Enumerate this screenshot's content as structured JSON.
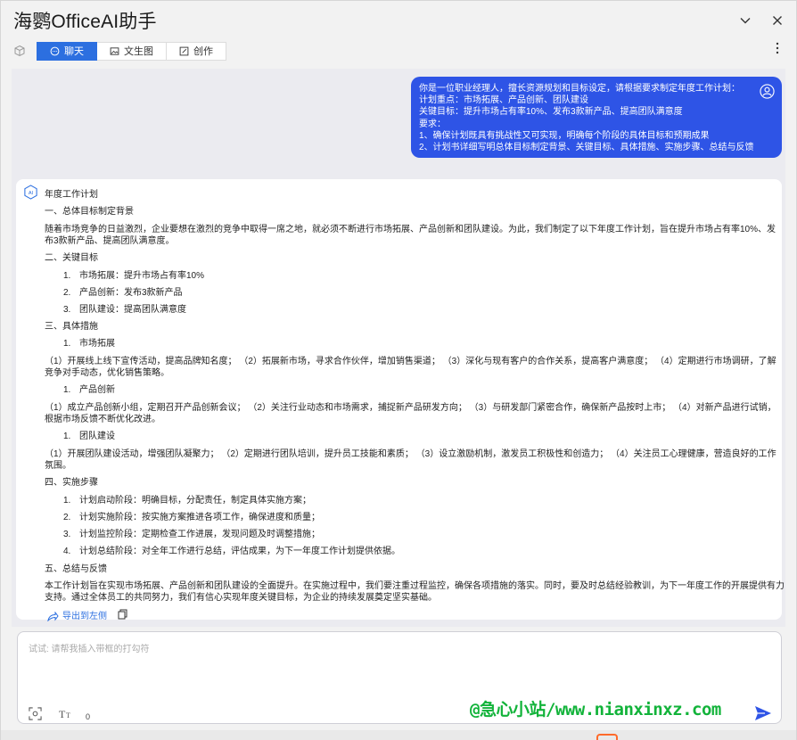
{
  "app": {
    "title": "海鹦OfficeAI助手"
  },
  "toolbar": {
    "tabs": [
      {
        "label": "聊天",
        "icon": "chat-icon",
        "active": true
      },
      {
        "label": "文生图",
        "icon": "image-icon",
        "active": false
      },
      {
        "label": "创作",
        "icon": "edit-icon",
        "active": false
      }
    ]
  },
  "user_message": {
    "lines": [
      "你是一位职业经理人，擅长资源规划和目标设定，请根据要求制定年度工作计划：",
      "计划重点：市场拓展、产品创新、团队建设",
      "关键目标：提升市场占有率10%、发布3款新产品、提高团队满意度",
      "要求：",
      "1、确保计划既具有挑战性又可实现，明确每个阶段的具体目标和预期成果",
      "2、计划书详细写明总体目标制定背景、关键目标、具体措施、实施步骤、总结与反馈"
    ]
  },
  "ai_response": {
    "title": "年度工作计划",
    "s1_heading": "一、总体目标制定背景",
    "s1_body": "随着市场竞争的日益激烈，企业要想在激烈的竞争中取得一席之地，就必须不断进行市场拓展、产品创新和团队建设。为此，我们制定了以下年度工作计划，旨在提升市场占有率10%、发布3款新产品、提高团队满意度。",
    "s2_heading": "二、关键目标",
    "s2_items": [
      "1.",
      "市场拓展：提升市场占有率10%",
      "2.",
      "产品创新：发布3款新产品",
      "3.",
      "团队建设：提高团队满意度"
    ],
    "s3_heading": "三、具体措施",
    "s3_sub1_num": "1.",
    "s3_sub1": "市场拓展",
    "s3_sub1_body": "（1）开展线上线下宣传活动，提高品牌知名度；  （2）拓展新市场，寻求合作伙伴，增加销售渠道；  （3）深化与现有客户的合作关系，提高客户满意度；  （4）定期进行市场调研，了解竞争对手动态，优化销售策略。",
    "s3_sub2_num": "1.",
    "s3_sub2": "产品创新",
    "s3_sub2_body": "（1）成立产品创新小组，定期召开产品创新会议；  （2）关注行业动态和市场需求，捕捉新产品研发方向；  （3）与研发部门紧密合作，确保新产品按时上市；  （4）对新产品进行试销，根据市场反馈不断优化改进。",
    "s3_sub3_num": "1.",
    "s3_sub3": "团队建设",
    "s3_sub3_body": "（1）开展团队建设活动，增强团队凝聚力；  （2）定期进行团队培训，提升员工技能和素质；  （3）设立激励机制，激发员工积极性和创造力；  （4）关注员工心理健康，营造良好的工作氛围。",
    "s4_heading": "四、实施步骤",
    "s4_items": [
      "1.",
      "计划启动阶段：明确目标，分配责任，制定具体实施方案；",
      "2.",
      "计划实施阶段：按实施方案推进各项工作，确保进度和质量；",
      "3.",
      "计划监控阶段：定期检查工作进展，发现问题及时调整措施；",
      "4.",
      "计划总结阶段：对全年工作进行总结，评估成果，为下一年度工作计划提供依据。"
    ],
    "s5_heading": "五、总结与反馈",
    "s5_body": "本工作计划旨在实现市场拓展、产品创新和团队建设的全面提升。在实施过程中，我们要注重过程监控，确保各项措施的落实。同时，要及时总结经验教训，为下一年度工作的开展提供有力支持。通过全体员工的共同努力，我们有信心实现年度关键目标，为企业的持续发展奠定坚实基础。",
    "export_label": "导出到左侧"
  },
  "input": {
    "placeholder": "试试: 请帮我插入带框的打勾符",
    "value": "",
    "char_count": "0"
  },
  "watermark": "@急心小站/www.nianxinxz.com"
}
